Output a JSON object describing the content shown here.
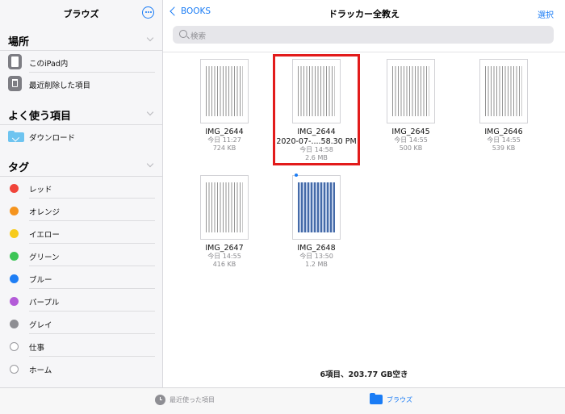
{
  "sidebar": {
    "title": "ブラウズ",
    "more_icon": "ellipsis-circle-icon",
    "sections": {
      "locations": {
        "title": "場所",
        "items": [
          {
            "label": "このiPad内",
            "icon": "ipad-icon"
          },
          {
            "label": "最近削除した項目",
            "icon": "trash-icon"
          }
        ]
      },
      "favorites": {
        "title": "よく使う項目",
        "items": [
          {
            "label": "ダウンロード",
            "icon": "download-folder-icon"
          }
        ]
      },
      "tags": {
        "title": "タグ",
        "items": [
          {
            "label": "レッド",
            "color": "#f0443a"
          },
          {
            "label": "オレンジ",
            "color": "#f5941e"
          },
          {
            "label": "イエロー",
            "color": "#f7cb1b"
          },
          {
            "label": "グリーン",
            "color": "#3cc556"
          },
          {
            "label": "ブルー",
            "color": "#1e7ef5"
          },
          {
            "label": "パープル",
            "color": "#b35bd8"
          },
          {
            "label": "グレイ",
            "color": "#8e8e93"
          },
          {
            "label": "仕事",
            "color": ""
          },
          {
            "label": "ホーム",
            "color": ""
          }
        ]
      }
    }
  },
  "nav": {
    "back_label": "BOOKS",
    "title": "ドラッカー全教え",
    "select_label": "選択"
  },
  "search": {
    "placeholder": "検索"
  },
  "files": [
    {
      "name": "IMG_2644",
      "name2": "",
      "date": "今日 11:27",
      "size": "724 KB",
      "style": "text"
    },
    {
      "name": "IMG_2644",
      "name2": "2020-07-....58.30 PM",
      "date": "今日 14:58",
      "size": "2.6 MB",
      "style": "text"
    },
    {
      "name": "IMG_2645",
      "name2": "",
      "date": "今日 14:55",
      "size": "500 KB",
      "style": "text"
    },
    {
      "name": "IMG_2646",
      "name2": "",
      "date": "今日 14:55",
      "size": "539 KB",
      "style": "text"
    },
    {
      "name": "IMG_2647",
      "name2": "",
      "date": "今日 14:55",
      "size": "416 KB",
      "style": "text"
    },
    {
      "name": "IMG_2648",
      "name2": "",
      "date": "今日 13:50",
      "size": "1.2 MB",
      "style": "blue"
    }
  ],
  "footer": {
    "count_text": "6項目、203.77 GB空き"
  },
  "tabbar": {
    "recents_label": "最近使った項目",
    "browse_label": "ブラウズ",
    "accent": "#1a7cf5"
  }
}
